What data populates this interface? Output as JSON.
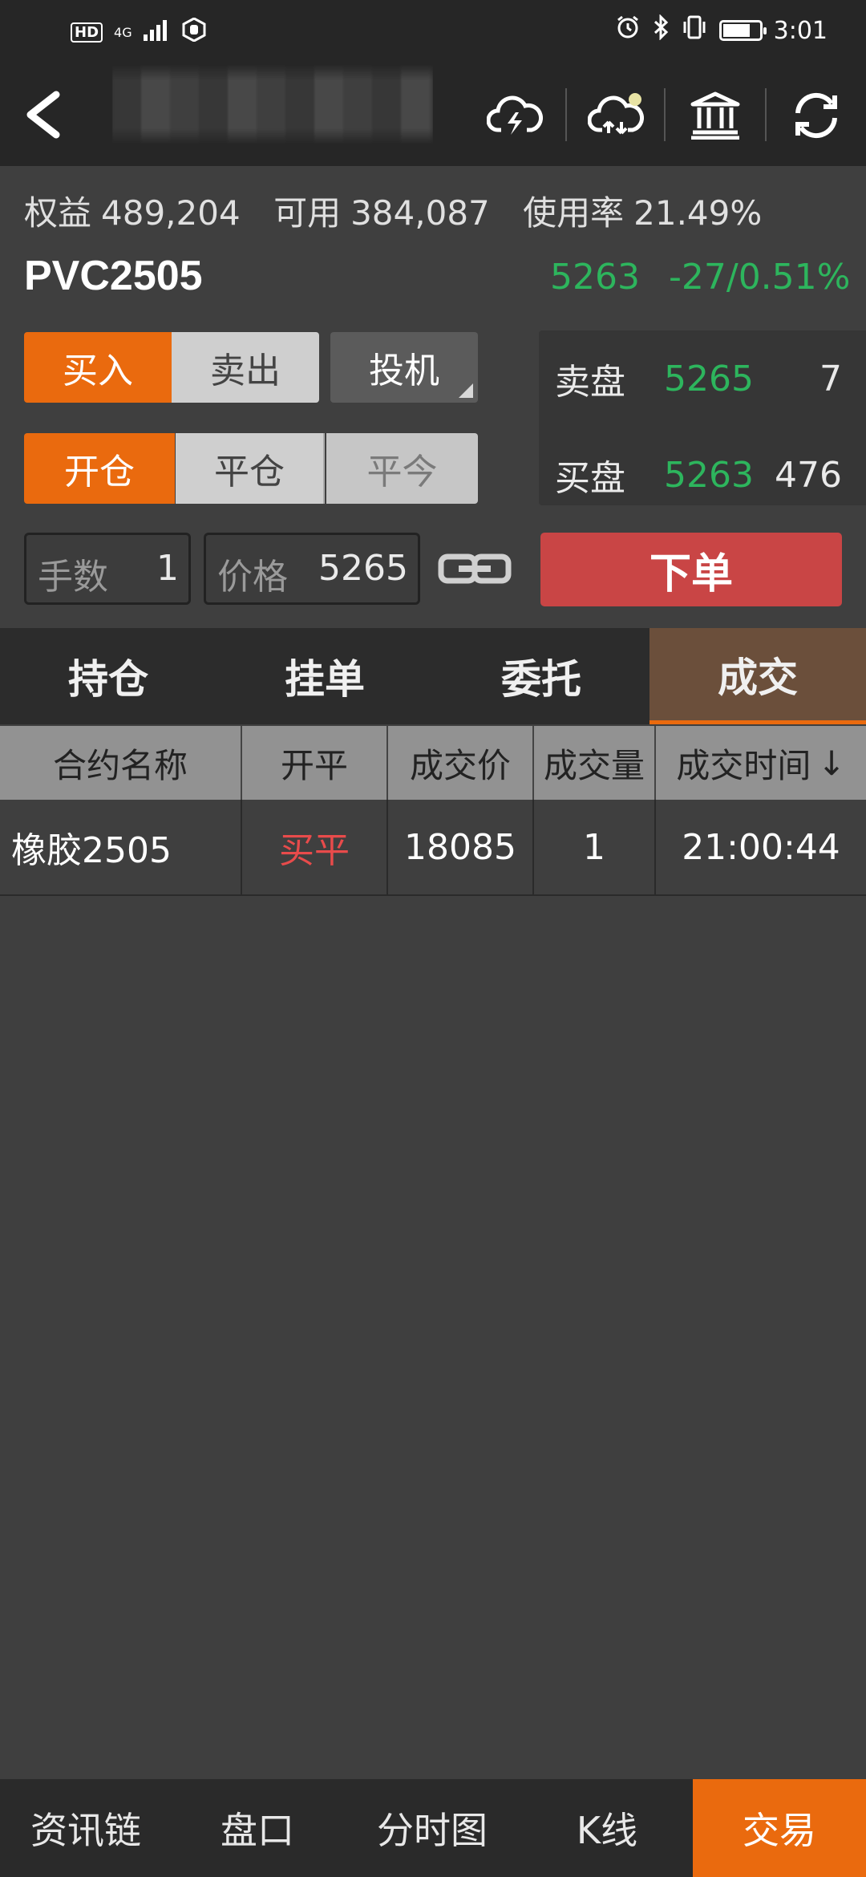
{
  "status_bar": {
    "hd": "HD",
    "network": "4G",
    "time": "3:01"
  },
  "account": {
    "equity_label": "权益",
    "equity_value": "489,204",
    "available_label": "可用",
    "available_value": "384,087",
    "usage_label": "使用率",
    "usage_value": "21.49%"
  },
  "contract": {
    "symbol": "PVC2505",
    "last_price": "5263",
    "change": "-27/0.51%"
  },
  "order_form": {
    "buy": "买入",
    "sell": "卖出",
    "type": "投机",
    "open": "开仓",
    "close": "平仓",
    "close_today": "平今",
    "qty_label": "手数",
    "qty_value": "1",
    "price_label": "价格",
    "price_value": "5265",
    "submit": "下单"
  },
  "orderbook": {
    "ask_label": "卖盘",
    "ask_price": "5265",
    "ask_volume": "7",
    "bid_label": "买盘",
    "bid_price": "5263",
    "bid_volume": "476"
  },
  "tabs": [
    {
      "label": "持仓"
    },
    {
      "label": "挂单"
    },
    {
      "label": "委托"
    },
    {
      "label": "成交"
    }
  ],
  "table": {
    "headers": [
      "合约名称",
      "开平",
      "成交价",
      "成交量",
      "成交时间"
    ],
    "sort_indicator": "↓",
    "rows": [
      {
        "name": "橡胶2505",
        "openclose": "买平",
        "price": "18085",
        "volume": "1",
        "time": "21:00:44"
      }
    ]
  },
  "bottom_nav": [
    {
      "label": "资讯链"
    },
    {
      "label": "盘口"
    },
    {
      "label": "分时图"
    },
    {
      "label": "K线"
    },
    {
      "label": "交易"
    }
  ],
  "colors": {
    "accent": "#ea6a0e",
    "up_green": "#2db55d",
    "sell_red": "#e84b4b",
    "submit_red": "#c94545"
  }
}
